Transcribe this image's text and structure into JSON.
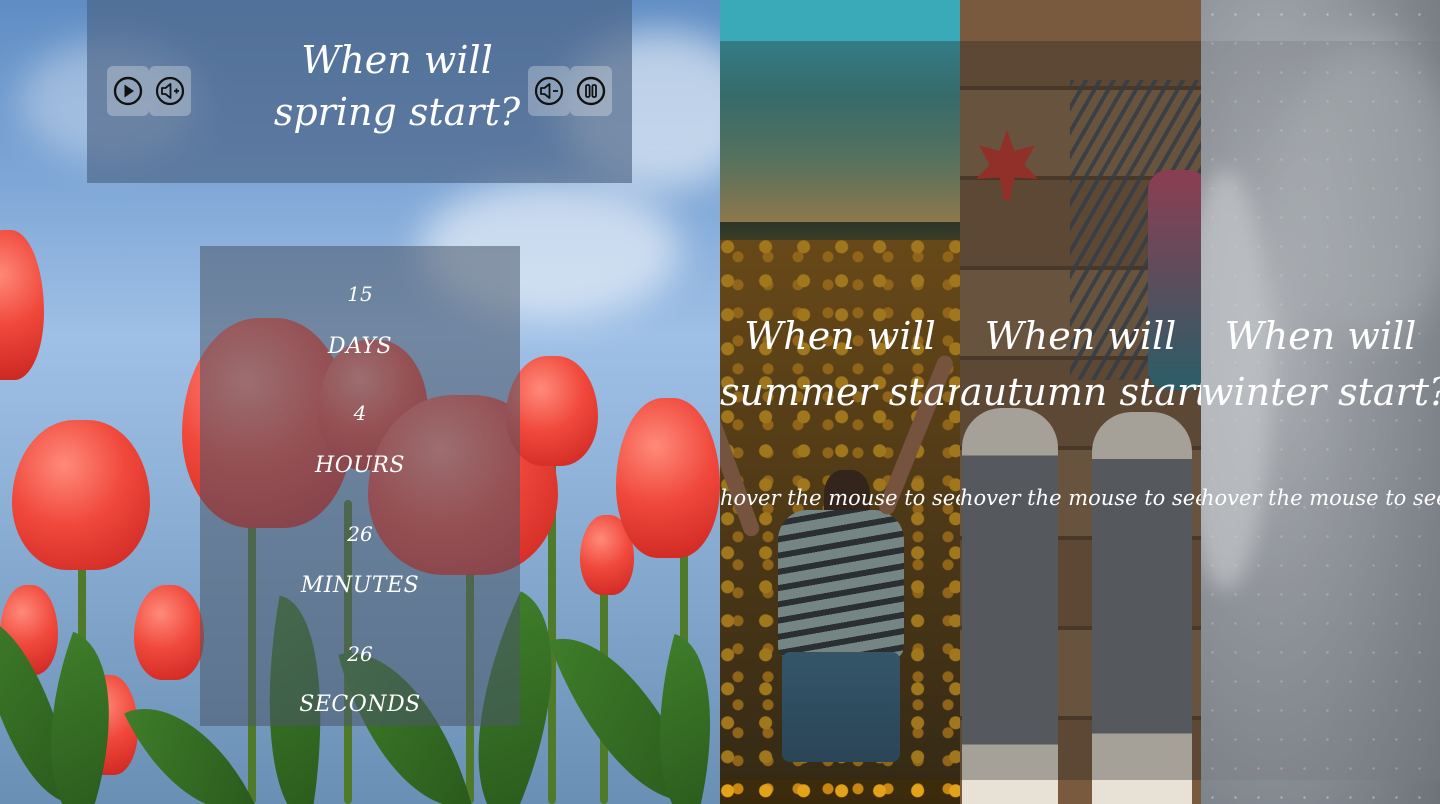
{
  "spring": {
    "title": "When will spring start?",
    "controls": {
      "play_icon": "play-icon",
      "volume_up_icon": "volume-up-icon",
      "volume_down_icon": "volume-down-icon",
      "pause_icon": "pause-icon"
    },
    "countdown": {
      "days_value": "15",
      "days_label": "DAYS",
      "hours_value": "4",
      "hours_label": "HOURS",
      "minutes_value": "26",
      "minutes_label": "MINUTES",
      "seconds_value": "26",
      "seconds_label": "SECONDS"
    }
  },
  "seasons": [
    {
      "title_line1": "When will",
      "title_line2": "summer start?",
      "hint": "hover the mouse to see"
    },
    {
      "title_line1": "When will",
      "title_line2": "autumn start?",
      "hint": "hover the mouse to see"
    },
    {
      "title_line1": "When will",
      "title_line2": "winter start?",
      "hint": "hover the mouse to see"
    }
  ],
  "colors": {
    "panel_overlay": "#485f80",
    "text": "#ffffff",
    "tulip_red": "#f0483b",
    "sky_blue": "#7ea6d6"
  }
}
